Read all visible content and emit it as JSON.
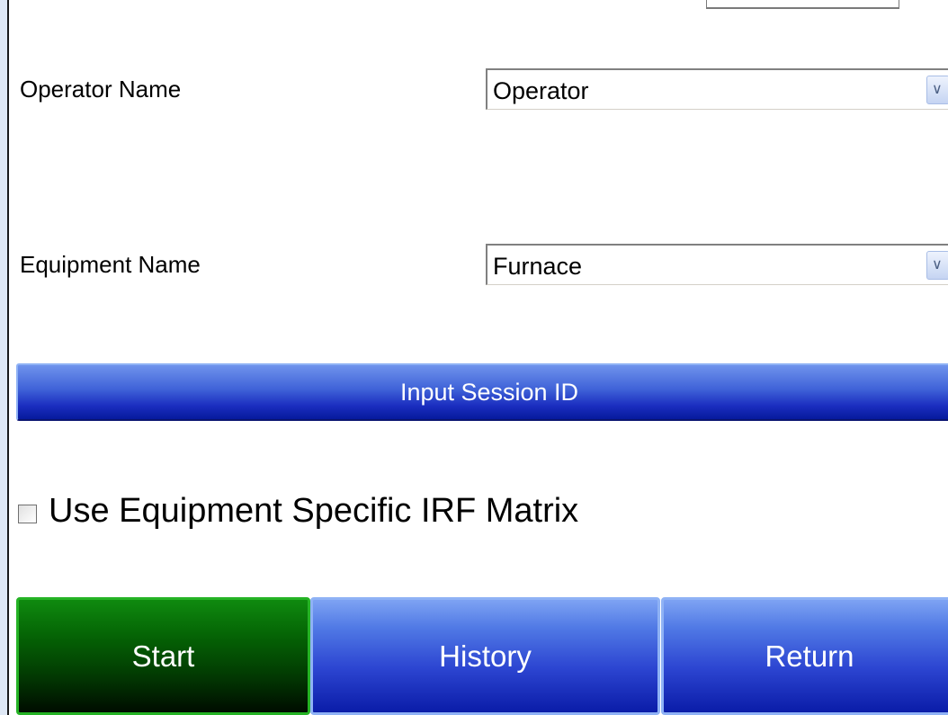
{
  "form": {
    "operator": {
      "label": "Operator Name",
      "value": "Operator"
    },
    "equipment": {
      "label": "Equipment Name",
      "value": "Furnace"
    },
    "session_button_label": "Input Session ID",
    "irf_checkbox": {
      "label": "Use Equipment Specific IRF Matrix",
      "checked": false
    }
  },
  "actions": {
    "start_label": "Start",
    "history_label": "History",
    "return_label": "Return"
  },
  "icons": {
    "dropdown": "chevron-down-icon"
  },
  "colors": {
    "start_button": "#056605",
    "action_button": "#2d46d2",
    "session_bar": "#3f62d8"
  }
}
